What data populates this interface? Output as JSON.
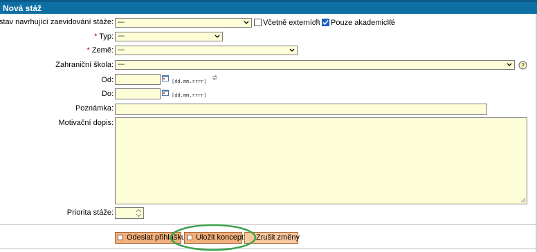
{
  "title": "Nová stáž",
  "fields": {
    "ustav": {
      "label": "Ústav navrhující zaevidování stáže:",
      "value": "---"
    },
    "vcetne_externich": "Včetně externích",
    "pouze_akademicke": "Pouze akademické",
    "typ": {
      "label": "Typ:",
      "value": "---"
    },
    "zeme": {
      "label": "Země:",
      "value": "---"
    },
    "zahranicni_skola": {
      "label": "Zahraniční škola:",
      "value": "---"
    },
    "od": {
      "label": "Od:",
      "hint": "[dd.mm.rrrr]"
    },
    "do": {
      "label": "Do:",
      "hint": "[dd.mm.rrrr]"
    },
    "poznamka": {
      "label": "Poznámka:"
    },
    "motivacni_dopis": {
      "label": "Motivační dopis:"
    },
    "priorita": {
      "label": "Priorita stáže:"
    }
  },
  "required_mark": "*",
  "buttons": {
    "odeslat": "Odeslat přihlášku",
    "ulozit": "Uložit koncept",
    "zrusit": "Zrušit změny"
  },
  "colors": {
    "header": "#0e6fa5",
    "field_bg": "#fdfdd8",
    "button": "#f2b07c",
    "highlight_ellipse": "#3aa14a"
  }
}
